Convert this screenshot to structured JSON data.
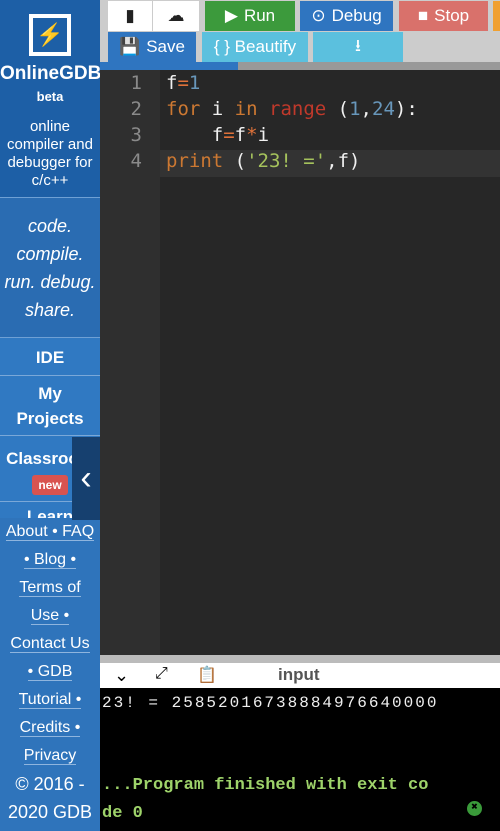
{
  "brand": {
    "name": "OnlineGDB",
    "beta": "beta",
    "desc": "online compiler and debugger for c/c++",
    "tagline": [
      "code.",
      "compile.",
      "run. debug.",
      "share."
    ]
  },
  "nav": {
    "ide": "IDE",
    "projects": "My Projects",
    "classroom": "Classroom",
    "new_badge": "new",
    "learn": "Learn"
  },
  "links": [
    "About • FAQ",
    "• Blog •",
    "Terms of",
    "Use •",
    "Contact Us",
    "• GDB",
    "Tutorial •",
    "Credits •",
    "Privacy",
    "© 2016 -",
    "2020 GDB"
  ],
  "toolbar": {
    "run": "Run",
    "debug": "Debug",
    "stop": "Stop",
    "save": "Save",
    "beautify": "{ } Beautify"
  },
  "colors": {
    "run": "#3c9a3c",
    "debug": "#2f75c0",
    "stop": "#d9716b",
    "beautify": "#5bc0de",
    "sidebar": "#2f74bb"
  },
  "editor": {
    "line_numbers": [
      "1",
      "2",
      "3",
      "4"
    ],
    "lines": [
      [
        [
          "f",
          ""
        ],
        [
          "=",
          "o"
        ],
        [
          "1",
          "n"
        ]
      ],
      [
        [
          "for",
          "k"
        ],
        [
          " i ",
          ""
        ],
        [
          "in",
          "k"
        ],
        [
          " ",
          ""
        ],
        [
          "range",
          "r"
        ],
        [
          " (",
          ""
        ],
        [
          "1",
          "n"
        ],
        [
          ",",
          ""
        ],
        [
          "24",
          "n"
        ],
        [
          "):",
          ""
        ]
      ],
      [
        [
          "    f",
          ""
        ],
        [
          "=",
          "o"
        ],
        [
          "f",
          ""
        ],
        [
          "*",
          "o"
        ],
        [
          "i",
          ""
        ]
      ],
      [
        [
          "print",
          "k"
        ],
        [
          " (",
          ""
        ],
        [
          "'23! ='",
          "s"
        ],
        [
          ",f)",
          ""
        ]
      ]
    ]
  },
  "output": {
    "tab": "input",
    "result": "23! = 25852016738884976640000",
    "finished": "...Program finished with exit co",
    "finished2": "de 0"
  }
}
